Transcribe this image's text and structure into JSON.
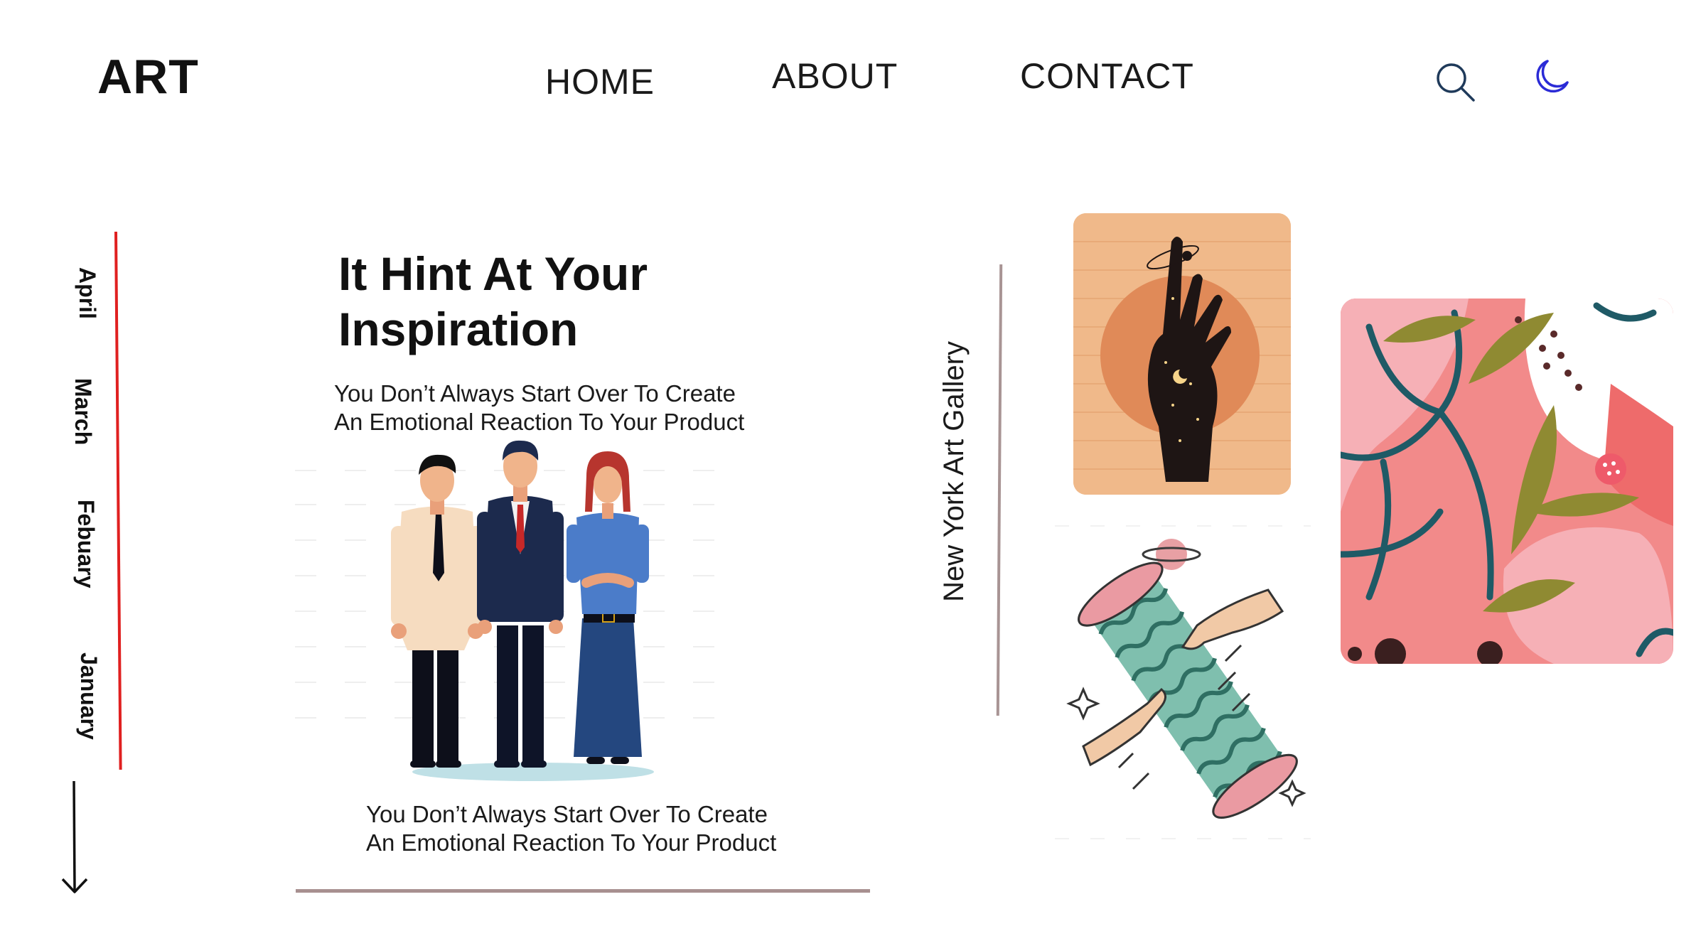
{
  "header": {
    "logo": "ART",
    "nav": {
      "home": "HOME",
      "about": "ABOUT",
      "contact": "CONTACT"
    },
    "icons": {
      "search": "search-icon",
      "theme_toggle": "moon-icon"
    },
    "accent_color": "#2b2bd6"
  },
  "timeline": {
    "months": [
      "April",
      "March",
      "Febuary",
      "January"
    ],
    "line_color": "#e02020",
    "arrow_icon": "arrow-down-icon"
  },
  "hero": {
    "title": "It Hint At Your Inspiration",
    "subtitle_top_line1": "You Don’t Always Start Over To  Create",
    "subtitle_top_line2": "An Emotional Reaction To Your Product",
    "subtitle_bottom_line1": "You Don’t Always Start Over To  Create",
    "subtitle_bottom_line2": "An Emotional Reaction To Your Product"
  },
  "gallery": {
    "label": "New York Art Gallery",
    "line_color": "#a89494"
  }
}
